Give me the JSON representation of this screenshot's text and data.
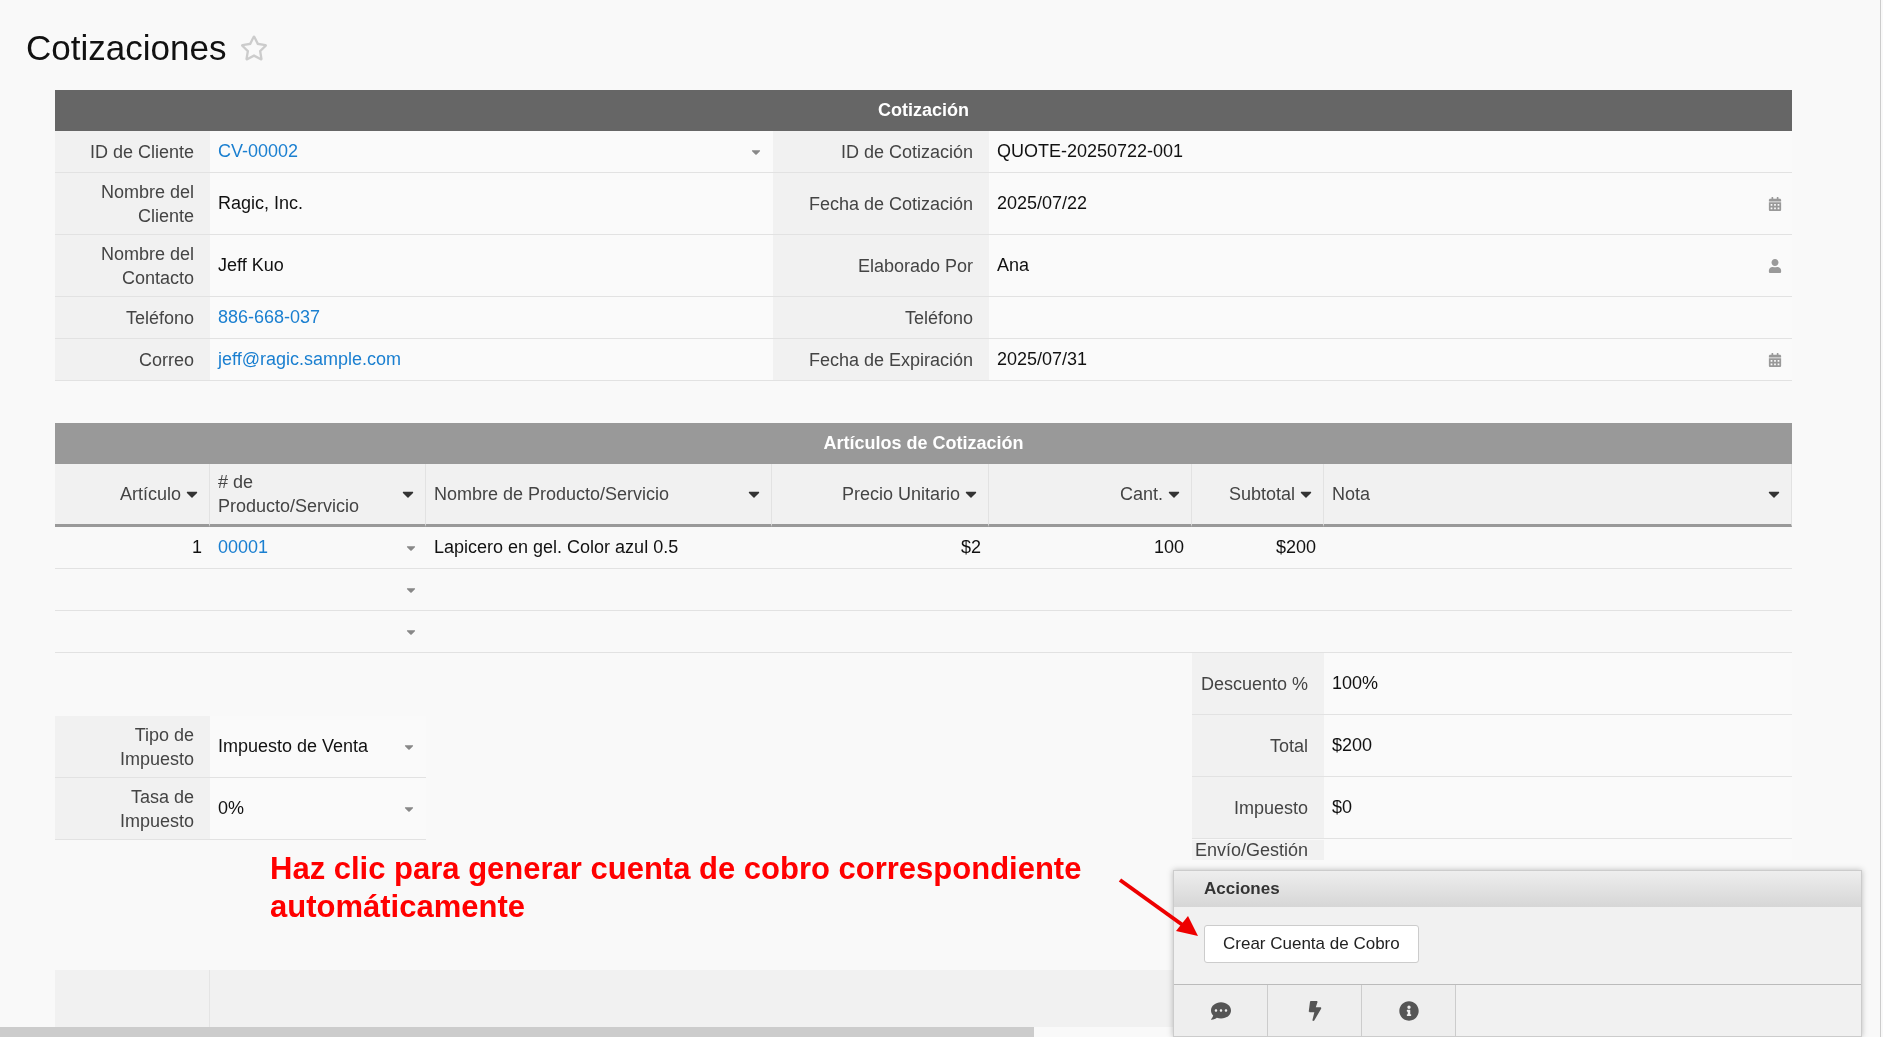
{
  "page_title": "Cotizaciones",
  "starred": false,
  "quote": {
    "title": "Cotización",
    "rows": [
      {
        "left": {
          "label": "ID de Cliente",
          "value": "CV-00002",
          "kind": "link-select"
        },
        "right": {
          "label": "ID de Cotización",
          "value": "QUOTE-20250722-001",
          "kind": "text"
        }
      },
      {
        "left": {
          "label": "Nombre del Cliente",
          "value": "Ragic, Inc.",
          "kind": "text"
        },
        "right": {
          "label": "Fecha de Cotización",
          "value": "2025/07/22",
          "kind": "date"
        }
      },
      {
        "left": {
          "label": "Nombre del Contacto",
          "value": "Jeff Kuo",
          "kind": "text"
        },
        "right": {
          "label": "Elaborado Por",
          "value": "Ana",
          "kind": "user"
        }
      },
      {
        "left": {
          "label": "Teléfono",
          "value": "886-668-037",
          "kind": "link"
        },
        "right": {
          "label": "Teléfono",
          "kind": "text"
        }
      },
      {
        "left": {
          "label": "Correo",
          "value": "jeff@ragic.sample.com",
          "kind": "link"
        },
        "right": {
          "label": "Fecha de Expiración",
          "value": "2025/07/31",
          "kind": "date"
        }
      }
    ]
  },
  "items": {
    "title": "Artículos de Cotización",
    "columns": [
      "Artículo",
      "# de Producto/Servicio",
      "Nombre de Producto/Servicio",
      "Precio Unitario",
      "Cant.",
      "Subtotal",
      "Nota"
    ],
    "rows": [
      {
        "kind": "entry",
        "item": "1",
        "product_no": "00001",
        "name": "Lapicero en gel. Color azul 0.5",
        "price": "$2",
        "qty": "100",
        "subtotal": "$200"
      },
      {
        "kind": "blank"
      },
      {
        "kind": "blank"
      }
    ]
  },
  "tax_fields": [
    {
      "label": "Tipo de Impuesto",
      "value": "Impuesto de Venta"
    },
    {
      "label": "Tasa de Impuesto",
      "value": "0%"
    }
  ],
  "totals": [
    {
      "label": "Descuento %",
      "value": "100%"
    },
    {
      "label": "Total",
      "value": "$200"
    },
    {
      "label": "Impuesto",
      "value": "$0"
    },
    {
      "label": "Envío/Gestión"
    }
  ],
  "annotation": "Haz clic para generar cuenta de cobro correspondiente automáticamente",
  "actions": {
    "title": "Acciones",
    "buttons": [
      "Crear Cuenta de Cobro"
    ]
  }
}
